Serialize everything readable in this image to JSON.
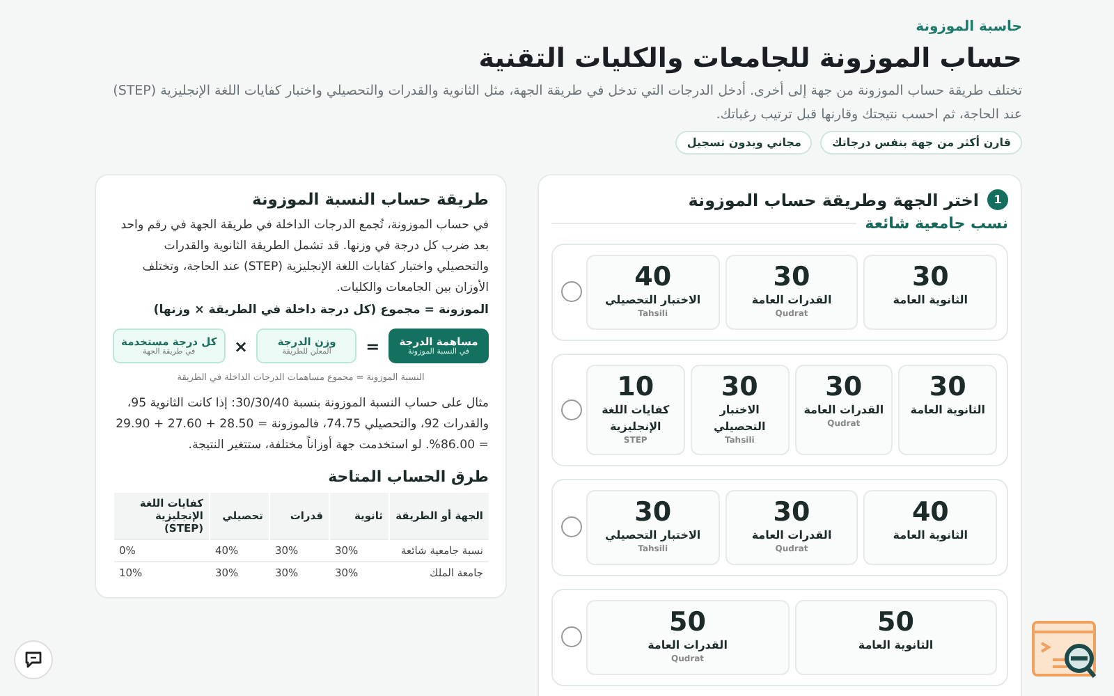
{
  "header": {
    "eyebrow": "حاسبة الموزونة",
    "title": "حساب الموزونة للجامعات والكليات التقنية",
    "intro": "تختلف طريقة حساب الموزونة من جهة إلى أخرى. أدخل الدرجات التي تدخل في طريقة الجهة، مثل الثانوية والقدرات والتحصيلي واختبار كفايات اللغة الإنجليزية (STEP) عند الحاجة، ثم احسب نتيجتك وقارنها قبل ترتيب رغباتك.",
    "chips": [
      "قارن أكثر من جهة بنفس درجاتك",
      "مجاني وبدون تسجيل"
    ]
  },
  "step": {
    "number": "1",
    "title": "اختر الجهة وطريقة حساب الموزونة",
    "section": "نسب جامعية شائعة",
    "options": [
      {
        "selected": false,
        "parts": [
          {
            "value": "30",
            "label": "الثانوية العامة"
          },
          {
            "value": "30",
            "label": "القدرات العامة",
            "sub": "Qudrat"
          },
          {
            "value": "40",
            "label": "الاختبار التحصيلي",
            "sub": "Tahsili"
          }
        ]
      },
      {
        "selected": false,
        "parts": [
          {
            "value": "30",
            "label": "الثانوية العامة"
          },
          {
            "value": "30",
            "label": "القدرات العامة",
            "sub": "Qudrat"
          },
          {
            "value": "30",
            "label": "الاختبار التحصيلي",
            "sub": "Tahsili"
          },
          {
            "value": "10",
            "label": "كفايات اللغة الإنجليزية",
            "sub": "STEP"
          }
        ]
      },
      {
        "selected": false,
        "parts": [
          {
            "value": "40",
            "label": "الثانوية العامة"
          },
          {
            "value": "30",
            "label": "القدرات العامة",
            "sub": "Qudrat"
          },
          {
            "value": "30",
            "label": "الاختبار التحصيلي",
            "sub": "Tahsili"
          }
        ]
      },
      {
        "selected": false,
        "parts": [
          {
            "value": "50",
            "label": "الثانوية العامة"
          },
          {
            "value": "50",
            "label": "القدرات العامة",
            "sub": "Qudrat"
          }
        ]
      }
    ]
  },
  "info": {
    "title": "طريقة حساب النسبة الموزونة",
    "body": "في حساب الموزونة، تُجمع الدرجات الداخلة في طريقة الجهة في رقم واحد بعد ضرب كل درجة في وزنها. قد تشمل الطريقة الثانوية والقدرات والتحصيلي واختبار كفايات اللغة الإنجليزية (STEP) عند الحاجة، وتختلف الأوزان بين الجامعات والكليات.",
    "formula": "الموزونة = مجموع (كل درجة داخلة في الطريقة × وزنها)",
    "equation": [
      {
        "kind": "result",
        "title": "مساهمة الدرجة",
        "sub": "في النسبة الموزونة"
      },
      {
        "kind": "operator",
        "title": "="
      },
      {
        "kind": "term",
        "title": "وزن الدرجة",
        "sub": "المعلن للطريقة"
      },
      {
        "kind": "operator",
        "title": "×"
      },
      {
        "kind": "term",
        "title": "كل درجة مستخدمة",
        "sub": "في طريقة الجهة"
      }
    ],
    "caption": "النسبة الموزونة = مجموع مساهمات الدرجات الداخلة في الطريقة",
    "example": "مثال على حساب النسبة الموزونة بنسبة 30/30/40: إذا كانت الثانوية 95، والقدرات 92، والتحصيلي 74.75، فالموزونة = 28.50 + 27.60 + 29.90 = 86.00%. لو استخدمت جهة أوزاناً مختلفة، ستتغير النتيجة.",
    "table_title": "طرق الحساب المتاحة",
    "table": {
      "columns": [
        "الجهة أو الطريقة",
        "ثانوية",
        "قدرات",
        "تحصيلي",
        "كفايات اللغة الإنجليزية (STEP)"
      ],
      "rows": [
        [
          "نسبة جامعية شائعة",
          "30%",
          "30%",
          "40%",
          "0%"
        ],
        [
          "جامعة الملك",
          "30%",
          "30%",
          "30%",
          "10%"
        ]
      ]
    }
  }
}
